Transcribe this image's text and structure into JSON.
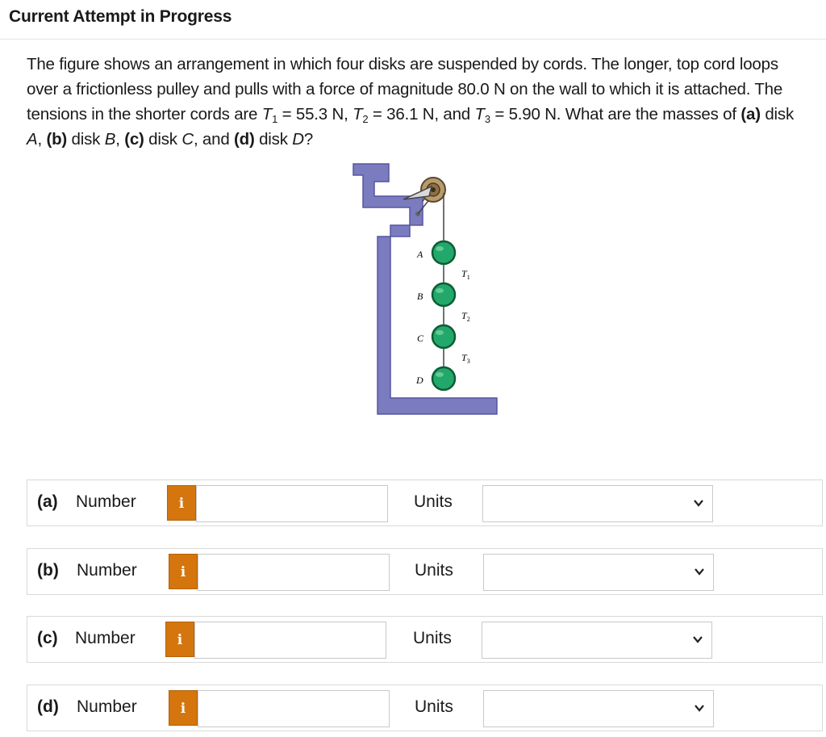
{
  "header": {
    "title": "Current Attempt in Progress"
  },
  "question": {
    "t1": "The figure shows an arrangement in which four disks are suspended by cords. The longer, top cord loops over a frictionless pulley and pulls with a force of magnitude 80.0 N on the wall to which it is attached. The tensions in the shorter cords are ",
    "T1_sym": "T",
    "T1_sub": "1",
    "T1_val": " = 55.3 N, ",
    "T2_sym": "T",
    "T2_sub": "2",
    "T2_val": " = 36.1 N, and ",
    "T3_sym": "T",
    "T3_sub": "3",
    "T3_val": " = 5.90 N. What are the masses of ",
    "a_label": "(a)",
    "a_text": " disk ",
    "a_disk": "A",
    "sep1": ", ",
    "b_label": "(b)",
    "b_text": " disk ",
    "b_disk": "B",
    "sep2": ", ",
    "c_label": "(c)",
    "c_text": " disk ",
    "c_disk": "C",
    "sep3": ", and ",
    "d_label": "(d)",
    "d_text": " disk ",
    "d_disk": "D",
    "end": "?"
  },
  "figure": {
    "disk_labels": [
      "A",
      "B",
      "C",
      "D"
    ],
    "tension_labels": [
      {
        "sym": "T",
        "sub": "1"
      },
      {
        "sym": "T",
        "sub": "2"
      },
      {
        "sym": "T",
        "sub": "3"
      }
    ],
    "colors": {
      "wall": "#7b7bc0",
      "disk": "#22a86a",
      "pulley": "#b99a6b"
    }
  },
  "rows": [
    {
      "label": "(a)",
      "number_label": "Number",
      "info": "i",
      "value": "",
      "units_label": "Units",
      "units_value": ""
    },
    {
      "label": "(b)",
      "number_label": "Number",
      "info": "i",
      "value": "",
      "units_label": "Units",
      "units_value": ""
    },
    {
      "label": "(c)",
      "number_label": "Number",
      "info": "i",
      "value": "",
      "units_label": "Units",
      "units_value": ""
    },
    {
      "label": "(d)",
      "number_label": "Number",
      "info": "i",
      "value": "",
      "units_label": "Units",
      "units_value": ""
    }
  ],
  "colors": {
    "info_button": "#d4750e",
    "border": "#d9d9d9"
  }
}
